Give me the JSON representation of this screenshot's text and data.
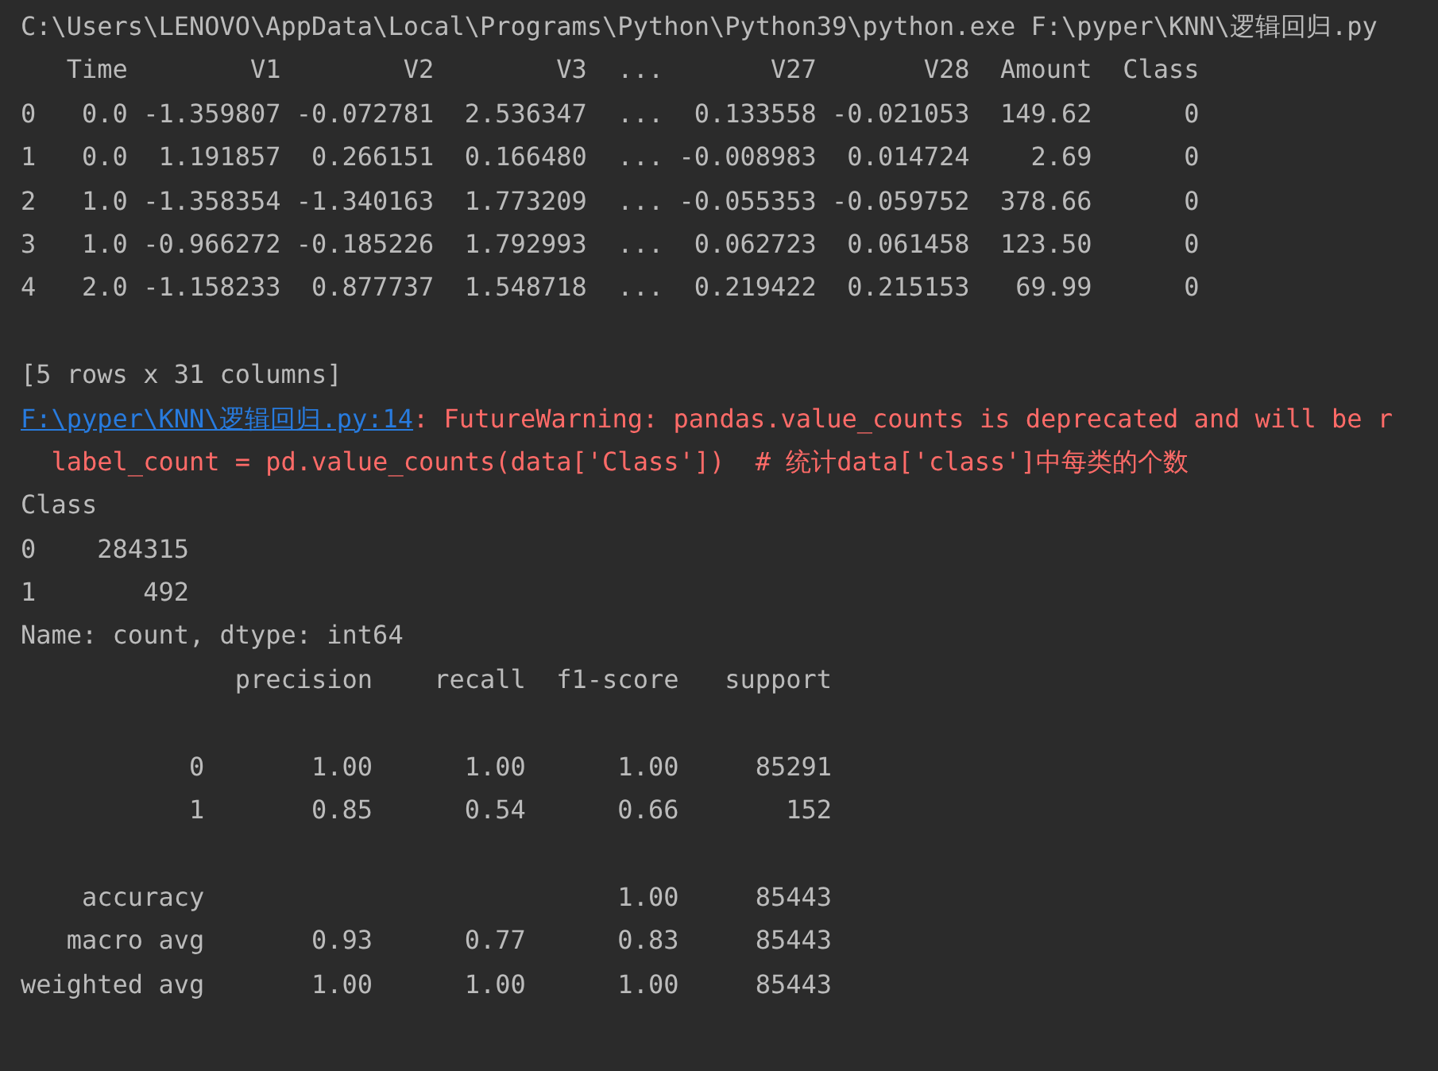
{
  "console": {
    "lines": [
      {
        "kind": "stdout",
        "text": "C:\\Users\\LENOVO\\AppData\\Local\\Programs\\Python\\Python39\\python.exe F:\\pyper\\KNN\\逻辑回归.py"
      },
      {
        "kind": "stdout",
        "text": "   Time        V1        V2        V3  ...       V27       V28  Amount  Class"
      },
      {
        "kind": "stdout",
        "text": "0   0.0 -1.359807 -0.072781  2.536347  ...  0.133558 -0.021053  149.62      0"
      },
      {
        "kind": "stdout",
        "text": "1   0.0  1.191857  0.266151  0.166480  ... -0.008983  0.014724    2.69      0"
      },
      {
        "kind": "stdout",
        "text": "2   1.0 -1.358354 -1.340163  1.773209  ... -0.055353 -0.059752  378.66      0"
      },
      {
        "kind": "stdout",
        "text": "3   1.0 -0.966272 -0.185226  1.792993  ...  0.062723  0.061458  123.50      0"
      },
      {
        "kind": "stdout",
        "text": "4   2.0 -1.158233  0.877737  1.548718  ...  0.219422  0.215153   69.99      0"
      },
      {
        "kind": "blank"
      },
      {
        "kind": "stdout",
        "text": "[5 rows x 31 columns]"
      },
      {
        "kind": "warning",
        "link": "F:\\pyper\\KNN\\逻辑回归.py:14",
        "text": ": FutureWarning: pandas.value_counts is deprecated and will be r"
      },
      {
        "kind": "stderr",
        "text": "  label_count = pd.value_counts(data['Class'])  # 统计data['class']中每类的个数"
      },
      {
        "kind": "stdout",
        "text": "Class"
      },
      {
        "kind": "stdout",
        "text": "0    284315"
      },
      {
        "kind": "stdout",
        "text": "1       492"
      },
      {
        "kind": "stdout",
        "text": "Name: count, dtype: int64"
      },
      {
        "kind": "stdout",
        "text": "              precision    recall  f1-score   support"
      },
      {
        "kind": "blank"
      },
      {
        "kind": "stdout",
        "text": "           0       1.00      1.00      1.00     85291"
      },
      {
        "kind": "stdout",
        "text": "           1       0.85      0.54      0.66       152"
      },
      {
        "kind": "blank"
      },
      {
        "kind": "stdout",
        "text": "    accuracy                           1.00     85443"
      },
      {
        "kind": "stdout",
        "text": "   macro avg       0.93      0.77      0.83     85443"
      },
      {
        "kind": "stdout",
        "text": "weighted avg       1.00      1.00      1.00     85443"
      }
    ]
  }
}
